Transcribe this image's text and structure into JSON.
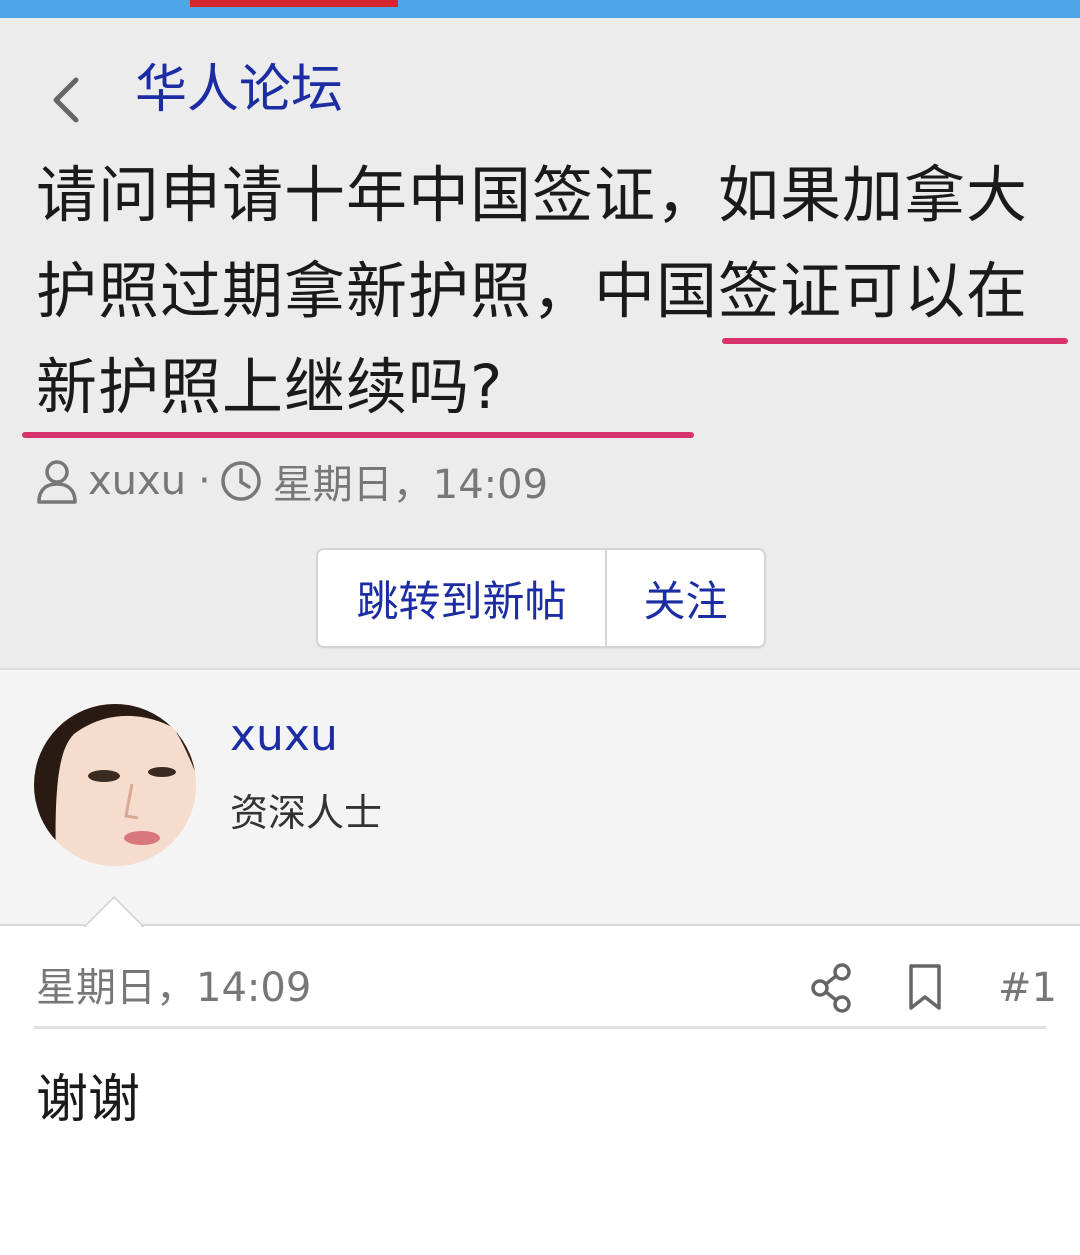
{
  "app": {
    "breadcrumb": "华人论坛",
    "colors": {
      "accent": "#1c2da3",
      "highlight": "#d8336c",
      "topbar": "#4fa6e6",
      "tab_indicator": "#d5262f"
    }
  },
  "thread": {
    "title_part1": "请问申请十年中国签证，如果加拿大护照过期拿新护照，",
    "title_part2": "中国签证可以在新护照上继续吗?",
    "author": "xuxu",
    "separator": "·",
    "time": "星期日，14:09",
    "jump_button": "跳转到新帖",
    "follow_button": "关注"
  },
  "post": {
    "author_name": "xuxu",
    "author_rank": "资深人士",
    "time": "星期日，14:09",
    "number": "#1",
    "body": "谢谢"
  },
  "icons": {
    "back": "chevron-left-icon",
    "user": "user-icon",
    "clock": "clock-icon",
    "share": "share-icon",
    "bookmark": "bookmark-icon"
  }
}
